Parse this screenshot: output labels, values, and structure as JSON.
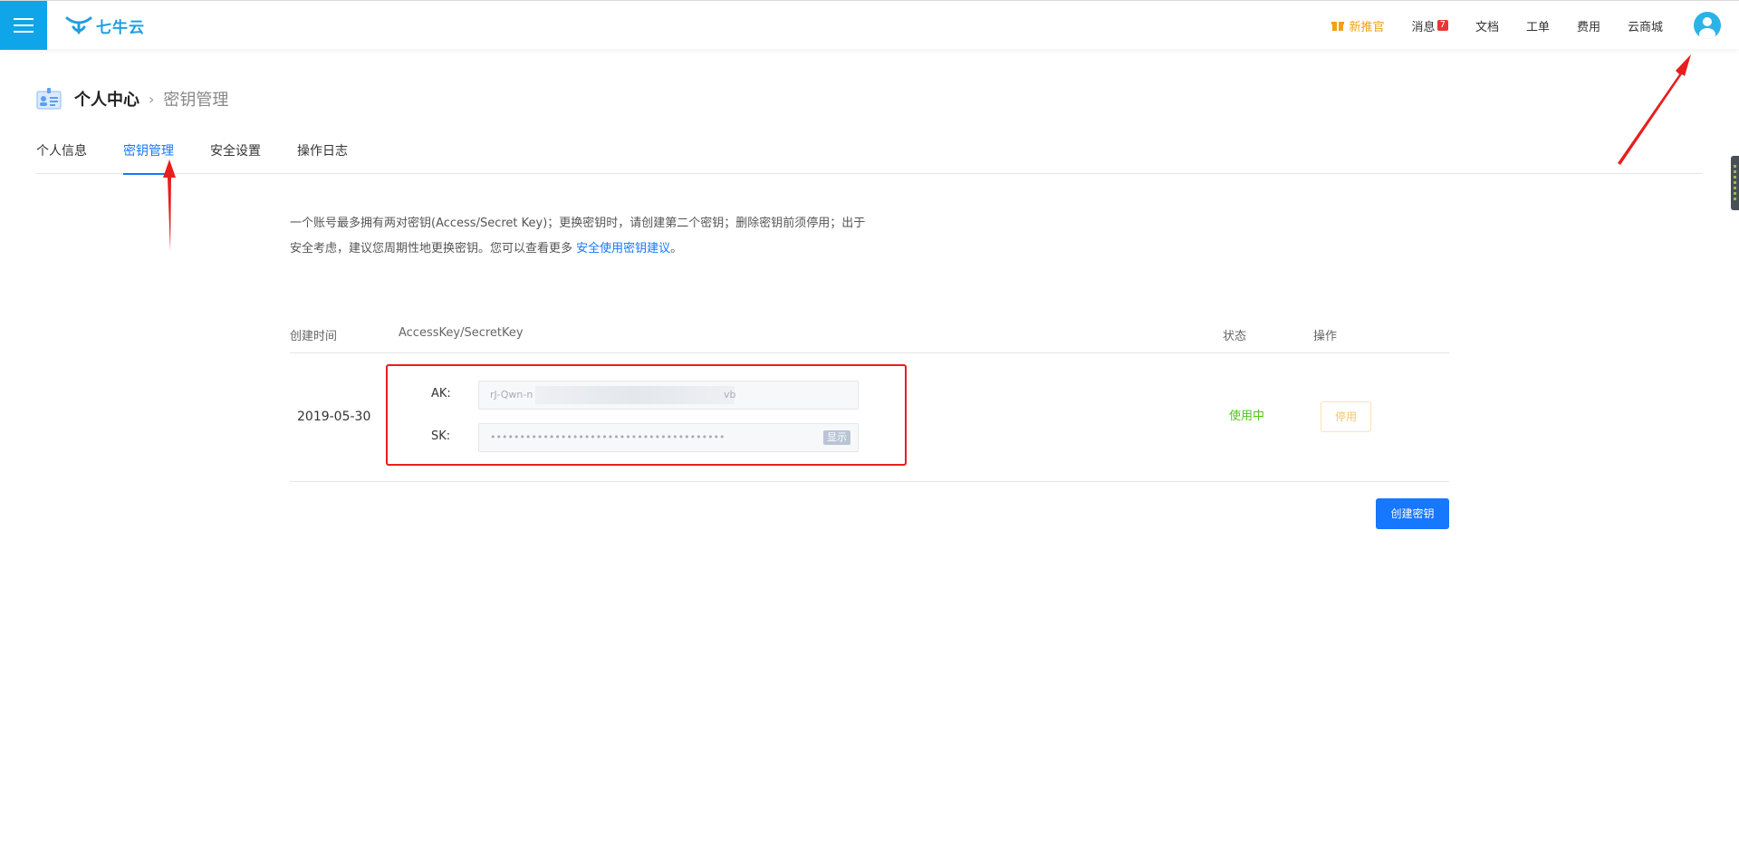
{
  "header": {
    "logo_text": "七牛云",
    "nav": [
      {
        "label": "新推官",
        "highlight": true
      },
      {
        "label": "消息",
        "badge": "7"
      },
      {
        "label": "文档"
      },
      {
        "label": "工单"
      },
      {
        "label": "费用"
      },
      {
        "label": "云商城"
      }
    ]
  },
  "breadcrumb": {
    "current": "个人中心",
    "separator": "›",
    "sub": "密钥管理"
  },
  "tabs": [
    {
      "label": "个人信息",
      "active": false
    },
    {
      "label": "密钥管理",
      "active": true
    },
    {
      "label": "安全设置",
      "active": false
    },
    {
      "label": "操作日志",
      "active": false
    }
  ],
  "description": {
    "text": "一个账号最多拥有两对密钥(Access/Secret Key)；更换密钥时，请创建第二个密钥；删除密钥前须停用；出于安全考虑，建议您周期性地更换密钥。您可以查看更多 ",
    "link": "安全使用密钥建议",
    "suffix": "。"
  },
  "table": {
    "columns": [
      "创建时间",
      "AccessKey/SecretKey",
      "状态",
      "操作"
    ],
    "rows": [
      {
        "created": "2019-05-30",
        "ak_label": "AK:",
        "ak_prefix": "rJ-Qwn-n",
        "ak_suffix": "vb",
        "sk_label": "SK:",
        "sk_masked": "••••••••••••••••••••••••••••••••••••••••",
        "show_label": "显示",
        "status": "使用中",
        "action": "停用"
      }
    ]
  },
  "create_button": "创建密钥",
  "colors": {
    "brand": "#0ea5e9",
    "link": "#1677ff",
    "status_active": "#52c41a",
    "annotation": "#e81e1e"
  }
}
